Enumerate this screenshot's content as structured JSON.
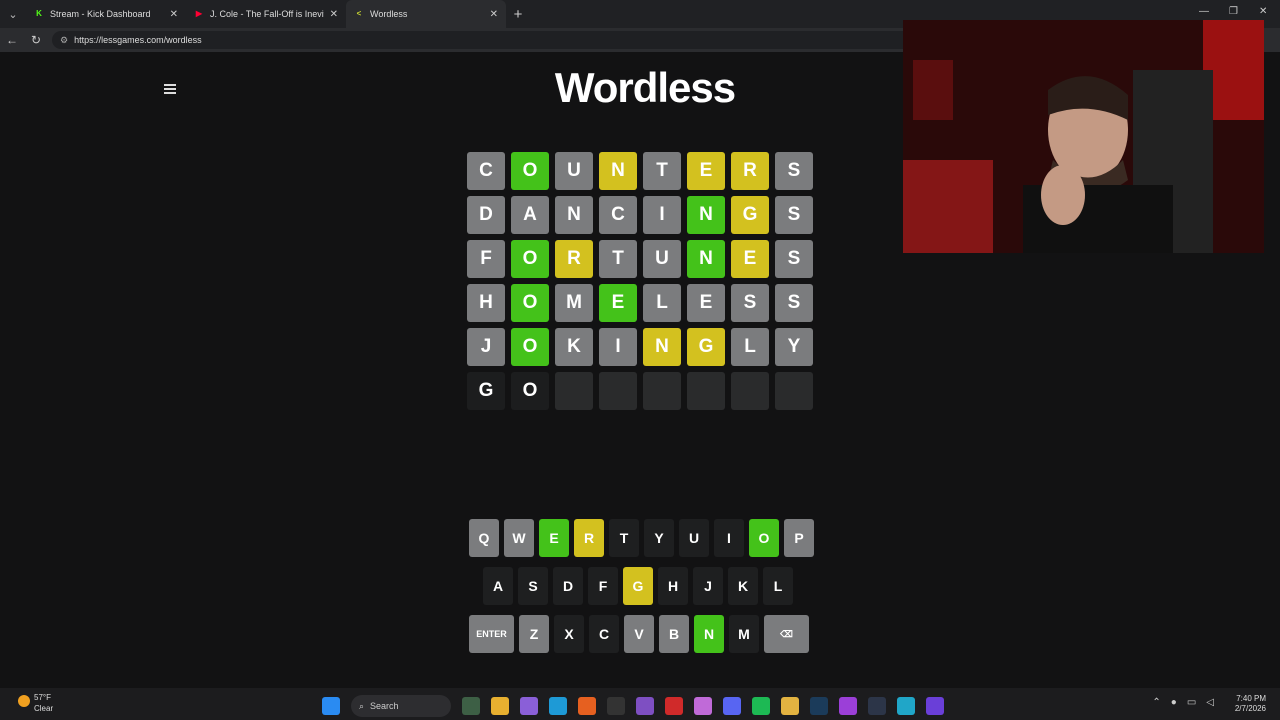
{
  "browser": {
    "tabs": [
      {
        "title": "Stream - Kick Dashboard",
        "icon": "K",
        "color": "#53fc18",
        "active": false
      },
      {
        "title": "J. Cole - The Fall-Off is Inevitable",
        "icon": "▶",
        "color": "#ff0033",
        "active": false
      },
      {
        "title": "Wordless",
        "icon": "<",
        "color": "#c6d432",
        "active": true
      }
    ],
    "url": "https://lessgames.com/wordless"
  },
  "page": {
    "title": "Wordless"
  },
  "board": [
    [
      {
        "l": "C",
        "s": "gray"
      },
      {
        "l": "O",
        "s": "green"
      },
      {
        "l": "U",
        "s": "gray"
      },
      {
        "l": "N",
        "s": "yellow"
      },
      {
        "l": "T",
        "s": "gray"
      },
      {
        "l": "E",
        "s": "yellow"
      },
      {
        "l": "R",
        "s": "yellow"
      },
      {
        "l": "S",
        "s": "gray"
      }
    ],
    [
      {
        "l": "D",
        "s": "gray"
      },
      {
        "l": "A",
        "s": "gray"
      },
      {
        "l": "N",
        "s": "gray"
      },
      {
        "l": "C",
        "s": "gray"
      },
      {
        "l": "I",
        "s": "gray"
      },
      {
        "l": "N",
        "s": "green"
      },
      {
        "l": "G",
        "s": "yellow"
      },
      {
        "l": "S",
        "s": "gray"
      }
    ],
    [
      {
        "l": "F",
        "s": "gray"
      },
      {
        "l": "O",
        "s": "green"
      },
      {
        "l": "R",
        "s": "yellow"
      },
      {
        "l": "T",
        "s": "gray"
      },
      {
        "l": "U",
        "s": "gray"
      },
      {
        "l": "N",
        "s": "green"
      },
      {
        "l": "E",
        "s": "yellow"
      },
      {
        "l": "S",
        "s": "gray"
      }
    ],
    [
      {
        "l": "H",
        "s": "gray"
      },
      {
        "l": "O",
        "s": "green"
      },
      {
        "l": "M",
        "s": "gray"
      },
      {
        "l": "E",
        "s": "green"
      },
      {
        "l": "L",
        "s": "gray"
      },
      {
        "l": "E",
        "s": "gray"
      },
      {
        "l": "S",
        "s": "gray"
      },
      {
        "l": "S",
        "s": "gray"
      }
    ],
    [
      {
        "l": "J",
        "s": "gray"
      },
      {
        "l": "O",
        "s": "green"
      },
      {
        "l": "K",
        "s": "gray"
      },
      {
        "l": "I",
        "s": "gray"
      },
      {
        "l": "N",
        "s": "yellow"
      },
      {
        "l": "G",
        "s": "yellow"
      },
      {
        "l": "L",
        "s": "gray"
      },
      {
        "l": "Y",
        "s": "gray"
      }
    ],
    [
      {
        "l": "G",
        "s": "typed"
      },
      {
        "l": "O",
        "s": "typed"
      },
      {
        "l": "",
        "s": "empty"
      },
      {
        "l": "",
        "s": "empty"
      },
      {
        "l": "",
        "s": "empty"
      },
      {
        "l": "",
        "s": "empty"
      },
      {
        "l": "",
        "s": "empty"
      },
      {
        "l": "",
        "s": "empty"
      }
    ]
  ],
  "keyboard": [
    [
      {
        "k": "Q",
        "s": "gray"
      },
      {
        "k": "W",
        "s": "gray"
      },
      {
        "k": "E",
        "s": "green"
      },
      {
        "k": "R",
        "s": "yellow"
      },
      {
        "k": "T",
        "s": "dark"
      },
      {
        "k": "Y",
        "s": "dark"
      },
      {
        "k": "U",
        "s": "dark"
      },
      {
        "k": "I",
        "s": "dark"
      },
      {
        "k": "O",
        "s": "green"
      },
      {
        "k": "P",
        "s": "gray"
      }
    ],
    [
      {
        "k": "A",
        "s": "dark"
      },
      {
        "k": "S",
        "s": "dark"
      },
      {
        "k": "D",
        "s": "dark"
      },
      {
        "k": "F",
        "s": "dark"
      },
      {
        "k": "G",
        "s": "yellow"
      },
      {
        "k": "H",
        "s": "dark"
      },
      {
        "k": "J",
        "s": "dark"
      },
      {
        "k": "K",
        "s": "dark"
      },
      {
        "k": "L",
        "s": "dark"
      }
    ],
    [
      {
        "k": "ENTER",
        "s": "gray",
        "wide": true
      },
      {
        "k": "Z",
        "s": "gray"
      },
      {
        "k": "X",
        "s": "dark"
      },
      {
        "k": "C",
        "s": "dark"
      },
      {
        "k": "V",
        "s": "gray"
      },
      {
        "k": "B",
        "s": "gray"
      },
      {
        "k": "N",
        "s": "green"
      },
      {
        "k": "M",
        "s": "dark"
      },
      {
        "k": "⌫",
        "s": "gray",
        "wide": true
      }
    ]
  ],
  "taskbar": {
    "weather_temp": "57°F",
    "weather_cond": "Clear",
    "search_label": "Search",
    "time": "7:40 PM",
    "date": "2/7/2026"
  },
  "colors": {
    "green": "#44c21a",
    "yellow": "#d3c11f",
    "gray": "#7b7c7e"
  }
}
